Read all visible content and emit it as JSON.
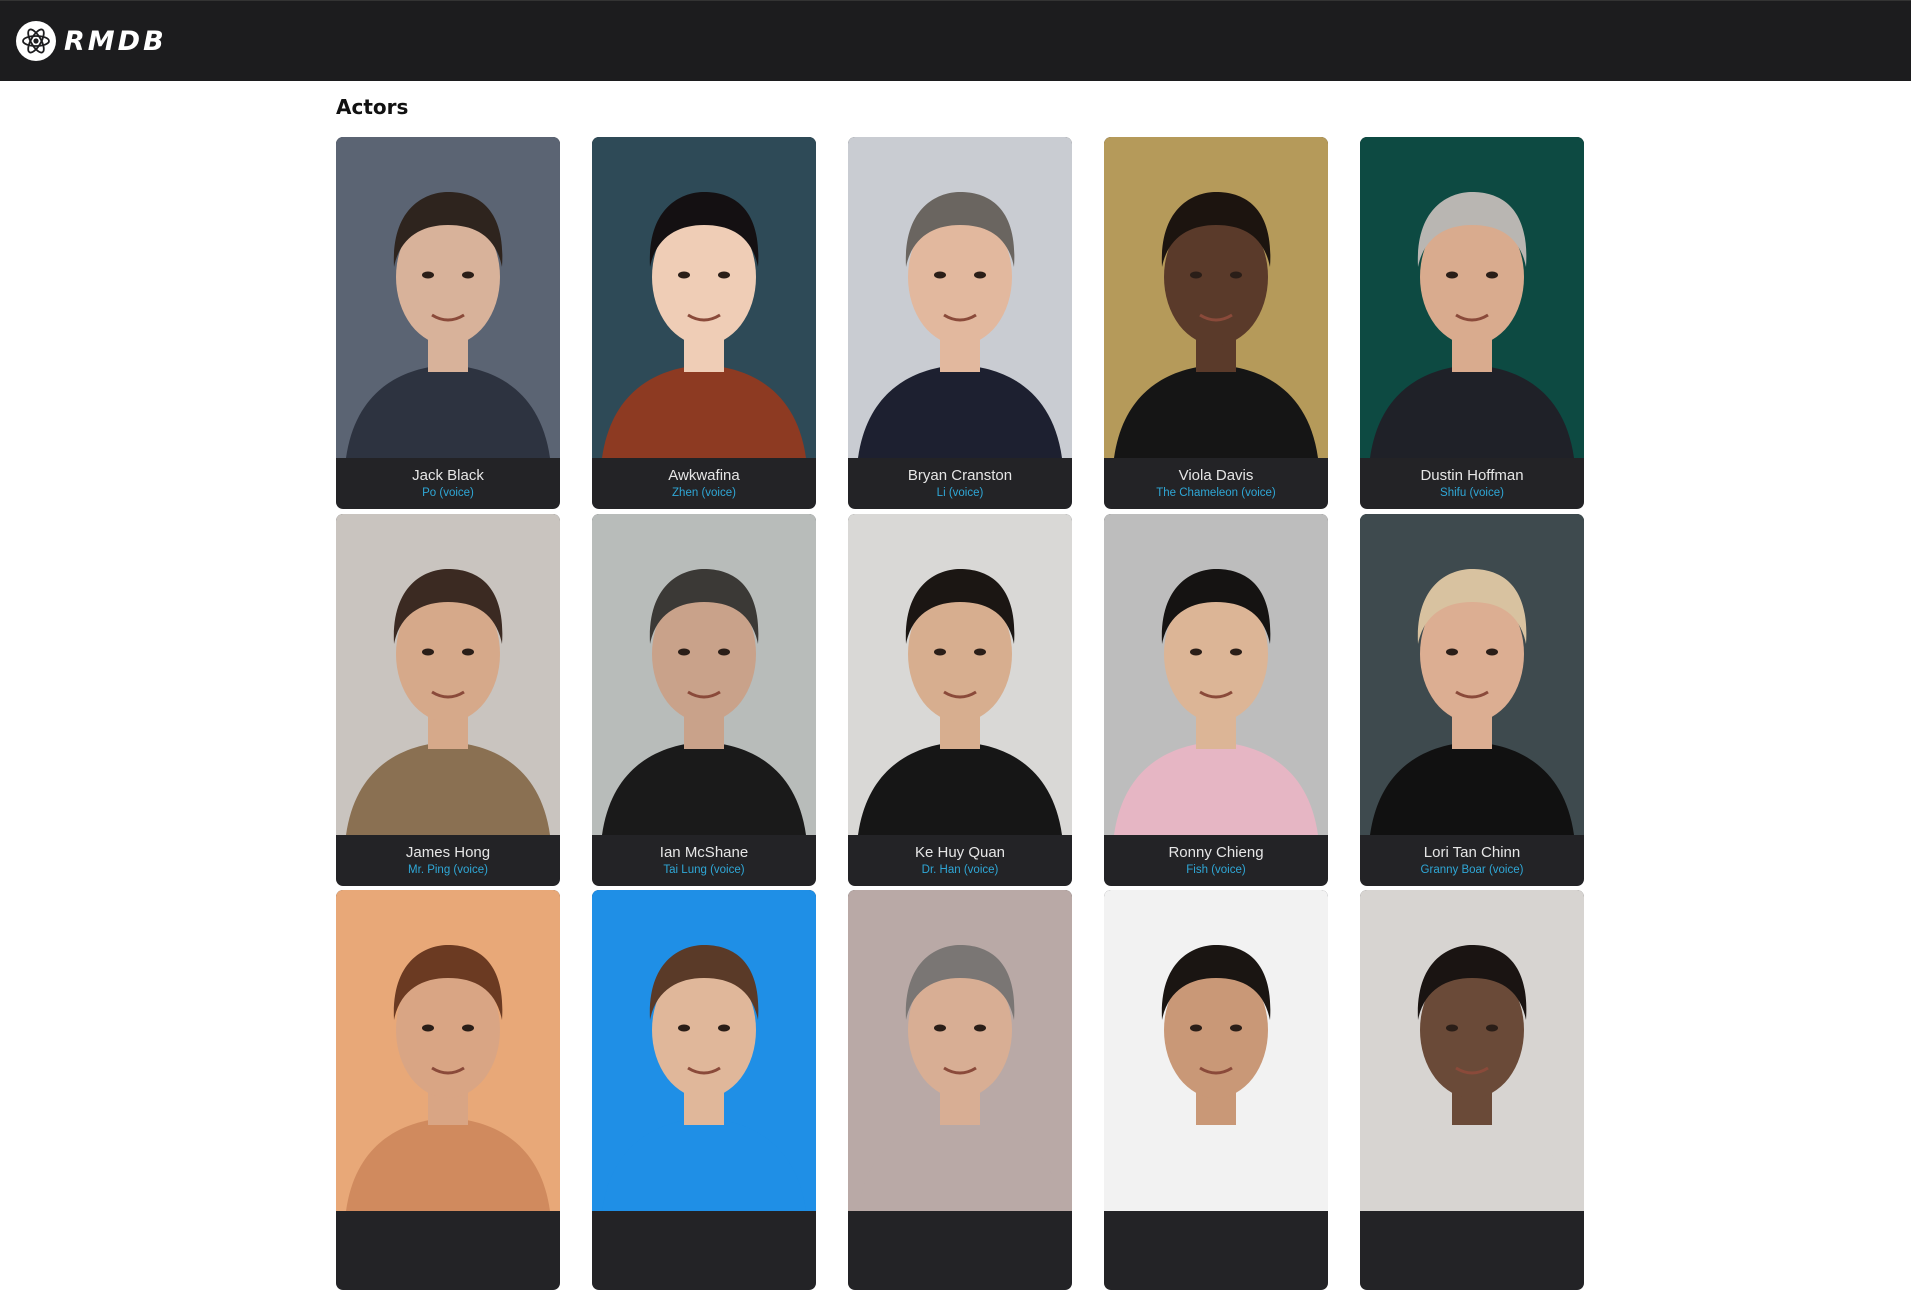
{
  "app": {
    "logo_text": "RMDB",
    "logo_icon": "atom-icon"
  },
  "section": {
    "title": "Actors"
  },
  "actors": [
    {
      "name": "Jack Black",
      "role": "Po (voice)",
      "bg": "#5b6473",
      "skin": "#d8b29a",
      "hair": "#2e241e",
      "shirt": "#2d3340"
    },
    {
      "name": "Awkwafina",
      "role": "Zhen (voice)",
      "bg": "#2e4a57",
      "skin": "#efcdb6",
      "hair": "#141012",
      "shirt": "#8d3a22"
    },
    {
      "name": "Bryan Cranston",
      "role": "Li (voice)",
      "bg": "#c9ccd2",
      "skin": "#e2b89e",
      "hair": "#6a6560",
      "shirt": "#1d2030"
    },
    {
      "name": "Viola Davis",
      "role": "The Chameleon (voice)",
      "bg": "#b59a5a",
      "skin": "#5a3a2a",
      "hair": "#1c140f",
      "shirt": "#151515"
    },
    {
      "name": "Dustin Hoffman",
      "role": "Shifu (voice)",
      "bg": "#0d4a42",
      "skin": "#d9ab8e",
      "hair": "#b9b6b2",
      "shirt": "#1f2128"
    },
    {
      "name": "James Hong",
      "role": "Mr. Ping (voice)",
      "bg": "#c9c4bf",
      "skin": "#d6a98a",
      "hair": "#3b2a22",
      "shirt": "#8a7052"
    },
    {
      "name": "Ian McShane",
      "role": "Tai Lung (voice)",
      "bg": "#b8bcba",
      "skin": "#c9a28a",
      "hair": "#3b3936",
      "shirt": "#1a1a1a"
    },
    {
      "name": "Ke Huy Quan",
      "role": "Dr. Han (voice)",
      "bg": "#d9d8d6",
      "skin": "#d7ae8f",
      "hair": "#1b1613",
      "shirt": "#161616"
    },
    {
      "name": "Ronny Chieng",
      "role": "Fish (voice)",
      "bg": "#bdbdbd",
      "skin": "#dcb596",
      "hair": "#151312",
      "shirt": "#e6b6c4"
    },
    {
      "name": "Lori Tan Chinn",
      "role": "Granny Boar (voice)",
      "bg": "#3e4a4e",
      "skin": "#dcae92",
      "hair": "#d8c2a0",
      "shirt": "#111111"
    },
    {
      "name": "",
      "role": "",
      "bg": "#e8a878",
      "skin": "#d9a584",
      "hair": "#6b3a22",
      "shirt": "#d08a5e"
    },
    {
      "name": "",
      "role": "",
      "bg": "#1f8fe6",
      "skin": "#e0b79a",
      "hair": "#5a3a28",
      "shirt": "#1f8fe6"
    },
    {
      "name": "",
      "role": "",
      "bg": "#b9a9a6",
      "skin": "#d8ae94",
      "hair": "#7a7674",
      "shirt": "#b9a9a6"
    },
    {
      "name": "",
      "role": "",
      "bg": "#f2f2f2",
      "skin": "#c99877",
      "hair": "#1a1512",
      "shirt": "#f2f2f2"
    },
    {
      "name": "",
      "role": "",
      "bg": "#d7d4d1",
      "skin": "#6a4a38",
      "hair": "#1a1412",
      "shirt": "#d7d4d1"
    }
  ]
}
